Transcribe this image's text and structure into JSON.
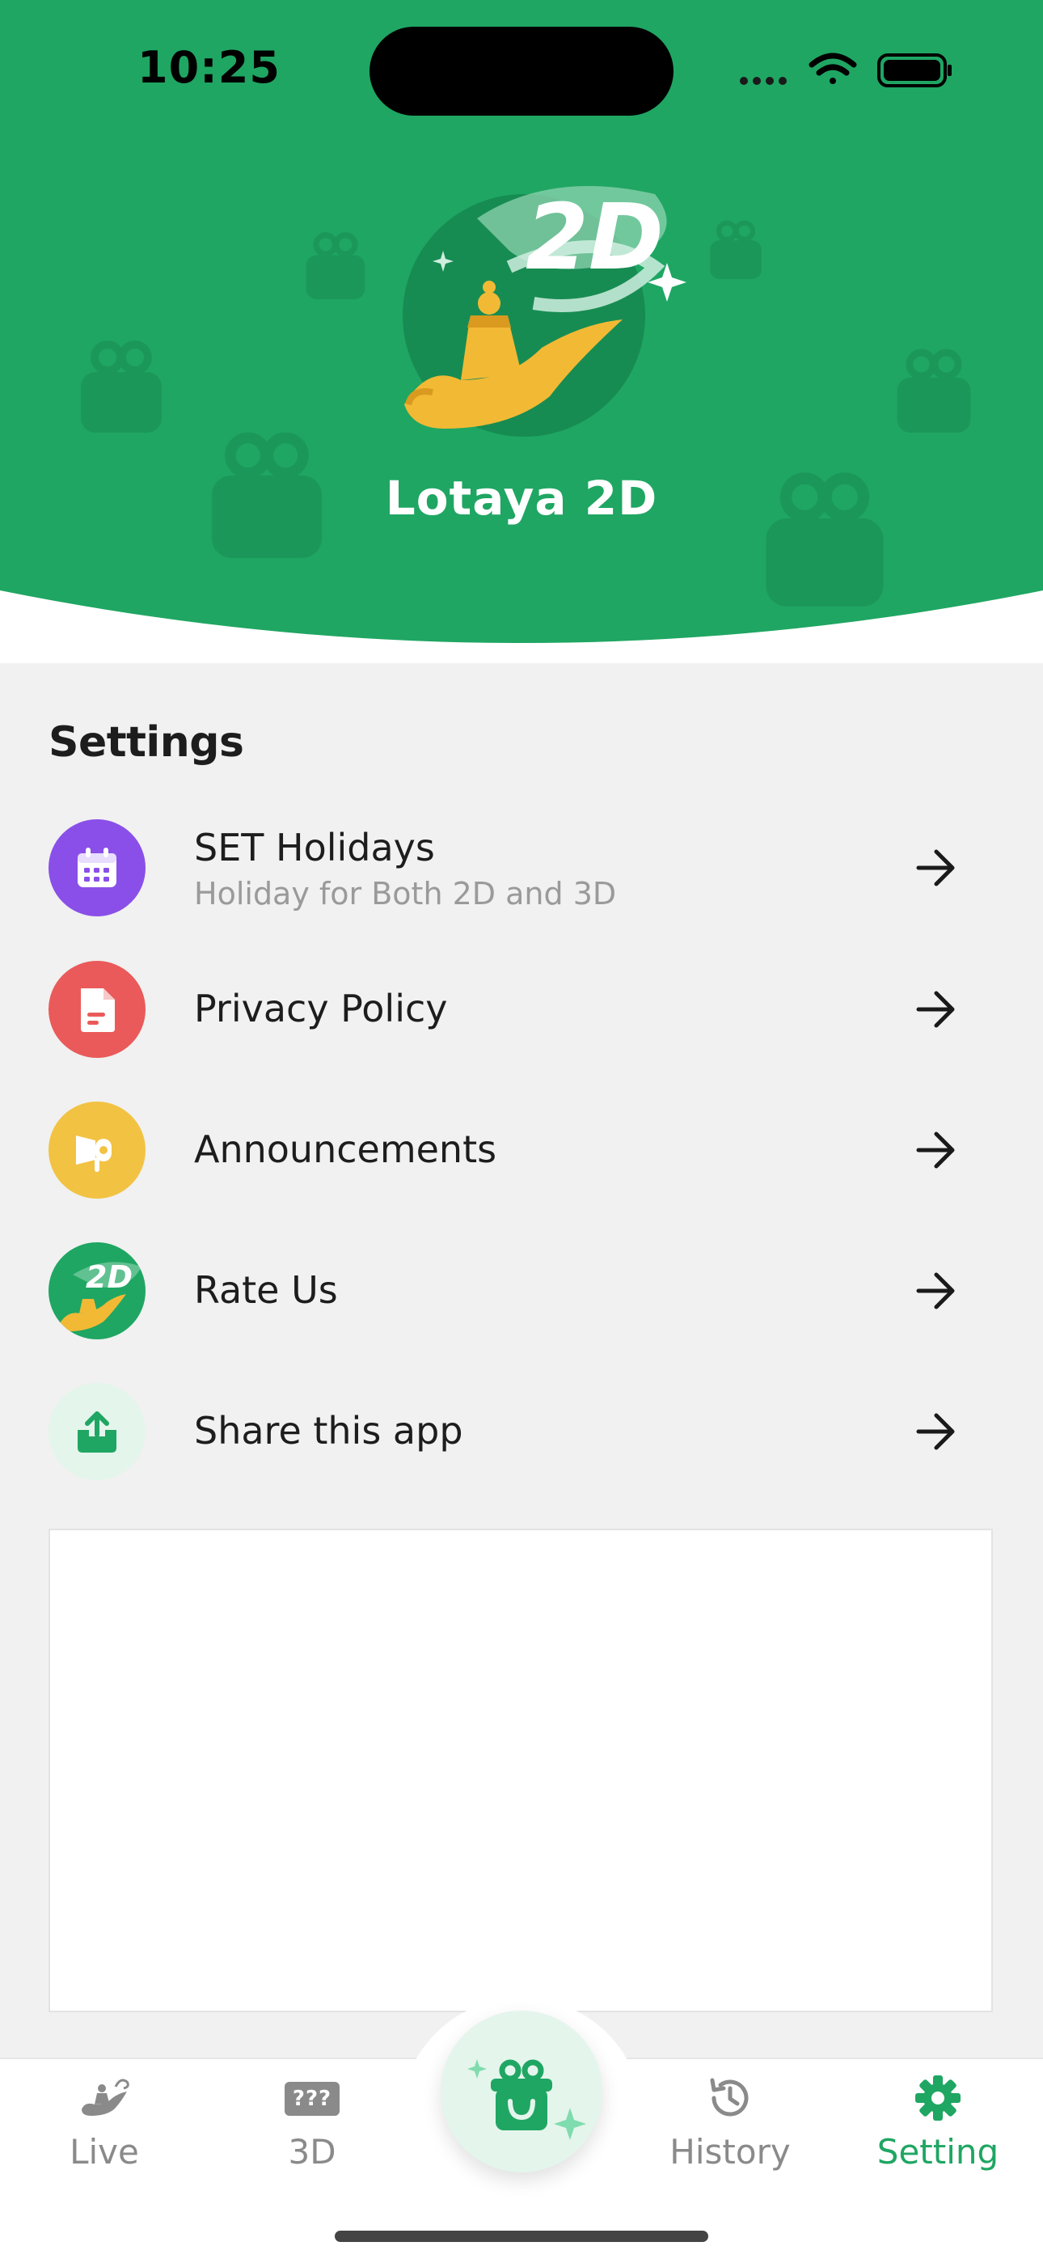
{
  "status_bar": {
    "time": "10:25"
  },
  "header": {
    "app_title": "Lotaya 2D",
    "logo_text": "2D"
  },
  "settings": {
    "title": "Settings",
    "items": [
      {
        "label": "SET Holidays",
        "subtitle": "Holiday for Both 2D and 3D",
        "icon": "calendar-icon",
        "color": "#8a4fe8"
      },
      {
        "label": "Privacy Policy",
        "icon": "document-icon",
        "color": "#ea5a5a"
      },
      {
        "label": "Announcements",
        "icon": "megaphone-icon",
        "color": "#f2c243"
      },
      {
        "label": "Rate Us",
        "icon": "app-logo-icon",
        "color": "#1fa663"
      },
      {
        "label": "Share this app",
        "icon": "share-icon",
        "color": "#e4f5ec"
      }
    ]
  },
  "tabbar": {
    "tabs": [
      {
        "label": "Live",
        "icon": "lamp-icon"
      },
      {
        "label": "3D",
        "icon": "3d-badge-icon",
        "badge": "???"
      },
      {
        "label": "",
        "icon": "gift-icon"
      },
      {
        "label": "History",
        "icon": "history-icon"
      },
      {
        "label": "Setting",
        "icon": "gear-icon"
      }
    ],
    "active": "Setting"
  },
  "colors": {
    "brand": "#1fa663",
    "background": "#f0f1f0"
  }
}
